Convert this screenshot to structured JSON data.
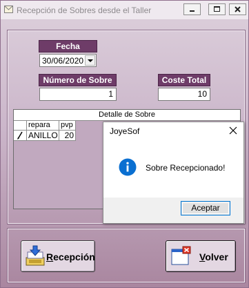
{
  "window": {
    "title": "Recepción de Sobres desde el Taller",
    "icons": {
      "app": "envelope-icon",
      "minimize": "minimize-icon",
      "maximize": "maximize-icon",
      "close": "close-icon"
    }
  },
  "form": {
    "fecha_label": "Fecha",
    "fecha_value": "30/06/2020",
    "numero_label": "Número de Sobre",
    "numero_value": "1",
    "coste_label": "Coste Total",
    "coste_value": "10"
  },
  "grid": {
    "caption": "Detalle de Sobre",
    "columns": [
      "repara",
      "pvp"
    ],
    "rows": [
      {
        "repara": "ANILLO",
        "pvp": "20"
      }
    ]
  },
  "dialog": {
    "title": "JoyeSof",
    "message": "Sobre Recepcionado!",
    "ok_label": "Aceptar",
    "icon": "info-icon"
  },
  "buttons": {
    "recepcion_first": "R",
    "recepcion_rest": "ecepción",
    "volver_first": "V",
    "volver_rest": "olver"
  },
  "colors": {
    "label_bg": "#6e3c68",
    "window_bg": "#cbb6ca",
    "accent": "#0078d7"
  }
}
